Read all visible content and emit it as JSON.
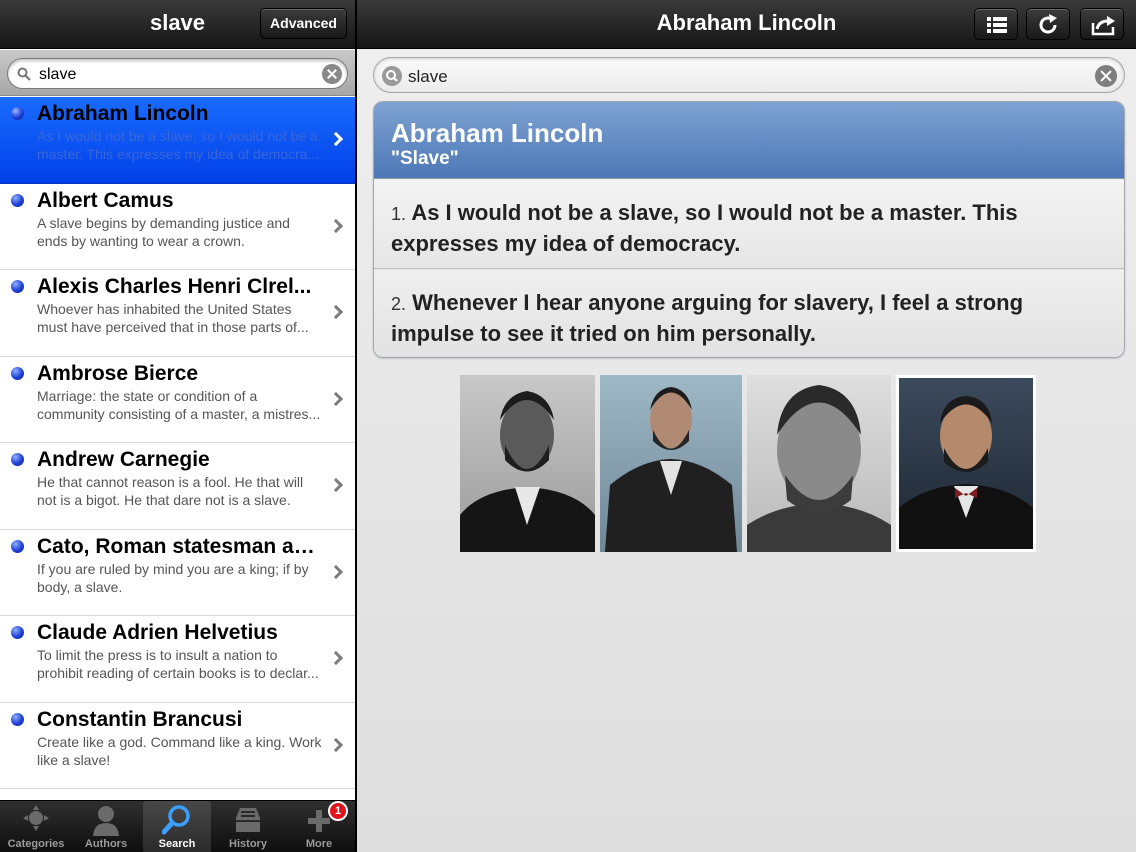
{
  "left_pane": {
    "title": "slave",
    "advanced_label": "Advanced",
    "search": {
      "value": "slave"
    },
    "items": [
      {
        "name": "Abraham Lincoln",
        "quote_line1": "As I would not be a slave, so I would not be a",
        "quote_line2": "master. This expresses my idea of democra...",
        "selected": true
      },
      {
        "name": "Albert Camus",
        "quote_line1": "A slave begins by demanding justice and",
        "quote_line2": "ends by wanting to wear a crown."
      },
      {
        "name": "Alexis Charles Henri Clrel...",
        "quote_line1": "Whoever has inhabited the United States",
        "quote_line2": "must have perceived that in those parts of..."
      },
      {
        "name": "Ambrose Bierce",
        "quote_line1": "Marriage: the state or condition of a",
        "quote_line2": "community consisting of a master, a mistres..."
      },
      {
        "name": "Andrew Carnegie",
        "quote_line1": "He that cannot reason is a fool. He that will",
        "quote_line2": "not is a bigot. He that dare not is a slave."
      },
      {
        "name": "Cato, Roman statesman an...",
        "quote_line1": "If you are ruled by mind you are a king; if by",
        "quote_line2": "body, a slave."
      },
      {
        "name": "Claude Adrien Helvetius",
        "quote_line1": "To limit the press is to insult a nation to",
        "quote_line2": "prohibit reading of certain books is to declar..."
      },
      {
        "name": "Constantin Brancusi",
        "quote_line1": "Create like a god. Command like a king. Work",
        "quote_line2": "like a slave!"
      }
    ],
    "tabs": [
      {
        "label": "Categories",
        "icon": "categories-icon"
      },
      {
        "label": "Authors",
        "icon": "authors-icon"
      },
      {
        "label": "Search",
        "icon": "search-icon",
        "active": true
      },
      {
        "label": "History",
        "icon": "history-icon"
      },
      {
        "label": "More",
        "icon": "more-icon",
        "badge": "1"
      }
    ]
  },
  "right_pane": {
    "title": "Abraham Lincoln",
    "toolbar": [
      "list-icon",
      "refresh-icon",
      "share-icon"
    ],
    "search": {
      "value": "slave"
    },
    "card": {
      "author": "Abraham Lincoln",
      "term": "\"Slave\"",
      "quotes": [
        {
          "num": "1.",
          "text": "As I would not be a slave, so I would not be a master. This expresses my idea of democracy."
        },
        {
          "num": "2.",
          "text": "Whenever I hear anyone arguing for slavery, I feel a strong impulse to see it tried on him personally."
        }
      ]
    }
  },
  "colors": {
    "selection_blue": "#0a5bf5",
    "card_header_blue": "#5f88c2",
    "badge_red": "#e0141d"
  }
}
